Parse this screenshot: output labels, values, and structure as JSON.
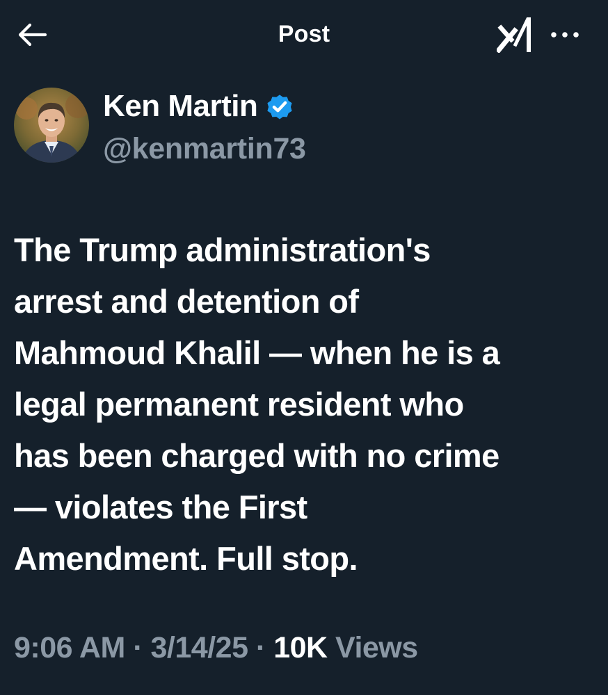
{
  "header": {
    "title": "Post",
    "back_icon": "arrow-left-icon",
    "grok_icon": "grok-icon",
    "more_icon": "more-horizontal-icon"
  },
  "author": {
    "display_name": "Ken Martin",
    "handle": "@kenmartin73",
    "verified": true,
    "verified_color": "#1d9bf0"
  },
  "post": {
    "text": "The Trump administration's\narrest and detention of\nMahmoud Khalil — when he is a\nlegal permanent resident who\nhas been charged with no crime\n— violates the First\nAmendment. Full stop."
  },
  "meta": {
    "time": "9:06 AM",
    "separator": " · ",
    "date": "3/14/25",
    "views_count": "10K",
    "views_label": " Views"
  },
  "colors": {
    "background": "#15202b",
    "text": "#ffffff",
    "secondary_text": "#8b98a5"
  }
}
